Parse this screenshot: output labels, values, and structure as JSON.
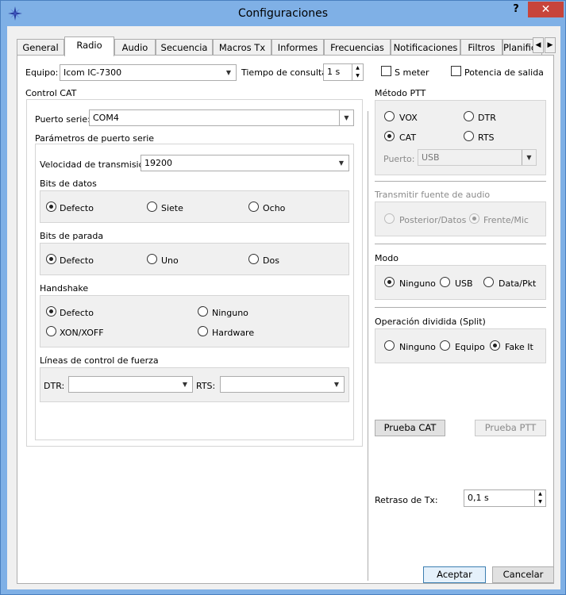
{
  "window": {
    "title": "Configuraciones",
    "help": "?",
    "close": "✕"
  },
  "tabs": [
    {
      "label": "General"
    },
    {
      "label": "Radio"
    },
    {
      "label": "Audio"
    },
    {
      "label": "Secuencia"
    },
    {
      "label": "Macros Tx"
    },
    {
      "label": "Informes"
    },
    {
      "label": "Frecuencias"
    },
    {
      "label": "Notificaciones"
    },
    {
      "label": "Filtros"
    },
    {
      "label": "Planifica"
    }
  ],
  "tab_scroll": {
    "left": "◀",
    "right": "▶"
  },
  "top": {
    "equipo_label": "Equipo:",
    "equipo_value": "Icom IC-7300",
    "tiempo_label": "Tiempo de consulta:",
    "tiempo_value": "1 s",
    "smeter_label": "S meter",
    "potencia_label": "Potencia de salida"
  },
  "cat": {
    "title": "Control CAT",
    "puerto_label": "Puerto serie:",
    "puerto_value": "COM4",
    "params_title": "Parámetros de puerto serie",
    "velocidad_label": "Velocidad de transmisión:",
    "velocidad_value": "19200",
    "bits_datos": {
      "title": "Bits de datos",
      "options": [
        "Defecto",
        "Siete",
        "Ocho"
      ],
      "selected": 0
    },
    "bits_parada": {
      "title": "Bits de parada",
      "options": [
        "Defecto",
        "Uno",
        "Dos"
      ],
      "selected": 0
    },
    "handshake": {
      "title": "Handshake",
      "options": [
        "Defecto",
        "Ninguno",
        "XON/XOFF",
        "Hardware"
      ],
      "selected": 0
    },
    "lineas": {
      "title": "Líneas de control de fuerza",
      "dtr_label": "DTR:",
      "rts_label": "RTS:",
      "dtr_value": "",
      "rts_value": ""
    }
  },
  "ptt": {
    "title": "Método PTT",
    "options": [
      "VOX",
      "DTR",
      "CAT",
      "RTS"
    ],
    "selected": 2,
    "puerto_label": "Puerto:",
    "puerto_value": "USB"
  },
  "audio": {
    "title": "Transmitir fuente de audio",
    "options": [
      "Posterior/Datos",
      "Frente/Mic"
    ],
    "selected": 1
  },
  "modo": {
    "title": "Modo",
    "options": [
      "Ninguno",
      "USB",
      "Data/Pkt"
    ],
    "selected": 0
  },
  "split": {
    "title": "Operación dividida (Split)",
    "options": [
      "Ninguno",
      "Equipo",
      "Fake It"
    ],
    "selected": 2
  },
  "buttons": {
    "prueba_cat": "Prueba CAT",
    "prueba_ptt": "Prueba PTT",
    "aceptar": "Aceptar",
    "cancelar": "Cancelar"
  },
  "retraso": {
    "label": "Retraso de Tx:",
    "value": "0,1 s"
  },
  "icons": {
    "arrow": "▼",
    "spin_up": "▲",
    "spin_down": "▼"
  }
}
